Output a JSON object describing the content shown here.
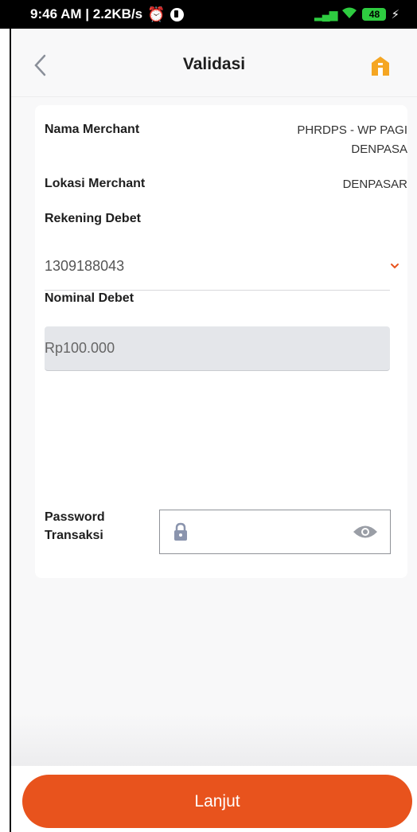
{
  "status_bar": {
    "time_speed": "9:46 AM | 2.2KB/s",
    "battery": "48"
  },
  "app_bar": {
    "title": "Validasi"
  },
  "form": {
    "merchant_name_label": "Nama Merchant",
    "merchant_name_line1": "PHRDPS - WP PAGI",
    "merchant_name_line2": "DENPASA",
    "merchant_location_label": "Lokasi Merchant",
    "merchant_location_value": "DENPASAR",
    "debit_account_label": "Rekening Debet",
    "debit_account_value": "1309188043",
    "debit_amount_label": "Nominal Debet",
    "debit_amount_value": "Rp100.000",
    "password_label_line1": "Password",
    "password_label_line2": "Transaksi"
  },
  "actions": {
    "continue_label": "Lanjut"
  },
  "colors": {
    "accent": "#e8531d",
    "home_icon": "#f5a623",
    "status_green": "#2ecc40"
  }
}
